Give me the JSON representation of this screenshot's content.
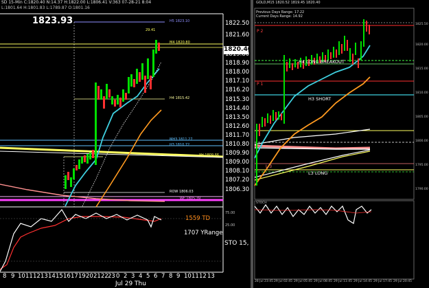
{
  "left_chart": {
    "header": "SD  15-Min  C:1820.40  N:14.37  H:1822.00  L:1806.41  V:363  07-28-21  8:04",
    "subheader": "L:1801.64  H:1801.83  L:1789.87  O:1801.16",
    "big_price": "1823.93",
    "price_badge": "1820.40",
    "price_axis": [
      "1822.50",
      "1821.60",
      "1819.80",
      "1818.90",
      "1818.00",
      "1817.10",
      "1816.20",
      "1815.30",
      "1814.40",
      "1813.50",
      "1812.60",
      "1811.70",
      "1810.80",
      "1809.90",
      "1809.00",
      "1808.10",
      "1807.20",
      "1806.30"
    ],
    "level_labels": {
      "h5": "H5  1823.10",
      "h4_top": "29.41",
      "m4": "M4  1820.80",
      "h4": "H4  1815.42",
      "mh3": "MH3  1811.27",
      "h3": "H3  1810.72",
      "yh": "YH  1809.66",
      "rom": "ROW  1806.03",
      "wf": "WF  1805.39"
    },
    "td_text": "1559 TD",
    "yrange_text": "1707 YRange",
    "sto_text": "STO  15,",
    "osc_axis": [
      "75.00",
      "25.00"
    ],
    "time_axis": [
      "8",
      "9",
      "10",
      "11",
      "12",
      "13",
      "14",
      "15",
      "16",
      "17",
      "19",
      "20",
      "21",
      "22",
      "23",
      "0",
      "2",
      "3",
      "4",
      "5",
      "6",
      "7",
      "8",
      "9",
      "10",
      "11",
      "12",
      "13"
    ],
    "date_label": "Jul 29 Thu"
  },
  "right_chart": {
    "header": "GOLD,M15  1820.52  1819.45  1820.40",
    "info_lines": [
      "Previous Days Range: 17.22",
      "Current Days Range: 14.92"
    ],
    "level_labels": {
      "p2": "P 2",
      "h4_long": "H4 LONG BREAKOUT",
      "p1": "P 1",
      "h3_short": "H3 SHORT",
      "l3_long": "L3 LONG",
      "l3": "L 3"
    },
    "price_axis": [
      "1825.50",
      "1820.00",
      "1815.00",
      "1810.00",
      "1805.00",
      "1800.00",
      "1795.00",
      "1790.00"
    ],
    "osc_header": "STOCH",
    "time_axis": [
      "28 Jul 23:45",
      "29 Jul 02:45",
      "29 Jul 05:45",
      "29 Jul 08:45",
      "29 Jul 11:45",
      "29 Jul 14:45",
      "29 Jul 17:45",
      "29 Jul 20:45"
    ]
  },
  "colors": {
    "bull_candle": "#00e000",
    "bear_candle": "#ff3030",
    "ma_fast": "#3fd0e0",
    "ma_slow": "#ff9a20",
    "level_yellow": "#ffff60",
    "level_magenta": "#ff40ff",
    "level_pink": "#ff8080",
    "level_white": "#ffffff"
  }
}
